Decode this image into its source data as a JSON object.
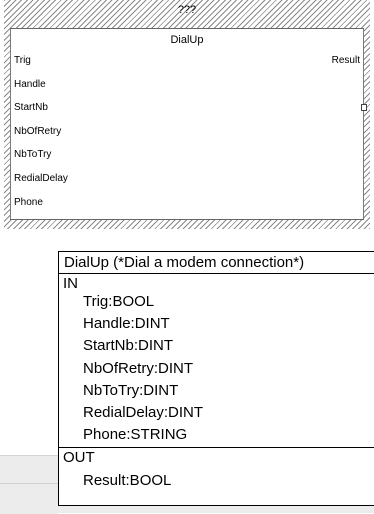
{
  "function_block": {
    "instance_name": "???",
    "type_name": "DialUp",
    "inputs": [
      "Trig",
      "Handle",
      "StartNb",
      "NbOfRetry",
      "NbToTry",
      "RedialDelay",
      "Phone"
    ],
    "outputs": [
      "Result"
    ]
  },
  "tooltip": {
    "header": "DialUp (*Dial a modem connection*)",
    "in_label": "IN",
    "in_vars": [
      "Trig:BOOL",
      "Handle:DINT",
      "StartNb:DINT",
      "NbOfRetry:DINT",
      "NbToTry:DINT",
      "RedialDelay:DINT",
      "Phone:STRING"
    ],
    "out_label": "OUT",
    "out_vars": [
      "Result:BOOL"
    ]
  }
}
